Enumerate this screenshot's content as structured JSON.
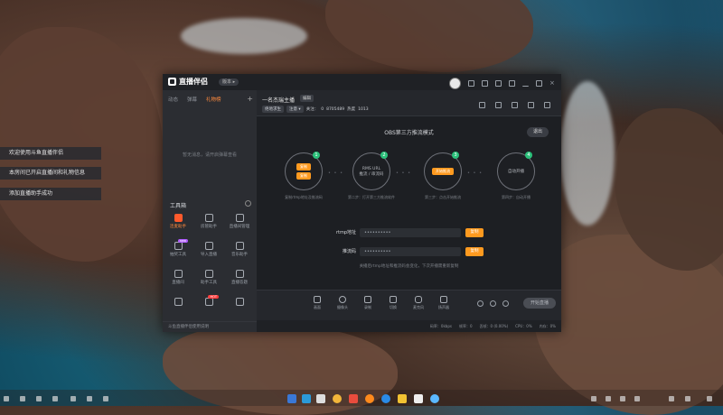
{
  "desktop": {
    "notifications": [
      "欢迎使用斗鱼直播伴侣",
      "本房间已开启直播间和礼物信息",
      "添加直播助手成功"
    ]
  },
  "window": {
    "app_name": "直播伴侣",
    "version_badge": "版本 ▸",
    "left": {
      "tabs": [
        "动态",
        "弹幕",
        "礼物榜"
      ],
      "plus": "+",
      "empty_text": "暂无消息，请开启弹幕查看",
      "tools_title": "工具箱",
      "tools": [
        {
          "label": "连麦助手",
          "tag": ""
        },
        {
          "label": "房管助手",
          "tag": ""
        },
        {
          "label": "直播间管理",
          "tag": ""
        },
        {
          "label": "抽奖工具",
          "tag": "new"
        },
        {
          "label": "导入直播",
          "tag": ""
        },
        {
          "label": "音乐助手",
          "tag": ""
        },
        {
          "label": "直播间",
          "tag": ""
        },
        {
          "label": "助手工具",
          "tag": ""
        },
        {
          "label": "直播答题",
          "tag": ""
        },
        {
          "label": "",
          "tag": ""
        },
        {
          "label": "",
          "tag": "HOT"
        },
        {
          "label": "",
          "tag": ""
        }
      ],
      "footer": "斗鱼直播伴侣使用说明"
    },
    "room": {
      "title": "一名杰瑞主播",
      "edit_label": "编辑",
      "category": "绝地求生",
      "level": "注意 ▾",
      "fans_label": "关注：",
      "fans_value": "0",
      "room_id": "8705489",
      "hot_label": "热度",
      "hot_value": "1013"
    },
    "obs": {
      "title": "OBS第三方推流模式",
      "exit_label": "退出",
      "steps": [
        {
          "num": "1",
          "pills": [
            "复制",
            "复制"
          ],
          "text": "",
          "caption": "复制rtmp地址及推流码"
        },
        {
          "num": "2",
          "pills": [],
          "text": "RMS URL\n推流 / 串流码",
          "caption": "第二步：打开第三方推流软件"
        },
        {
          "num": "3",
          "pills": [
            "开始推流"
          ],
          "text": "",
          "caption": "第三步：点击开始推流"
        },
        {
          "num": "4",
          "pills": [],
          "text": "自动开播",
          "caption": "第四步：自动开播"
        }
      ],
      "rtmp_label": "rtmp地址",
      "rtmp_value": "••••••••••",
      "key_label": "推流码",
      "key_value": "••••••••••",
      "copy_label": "复制",
      "hint": "关播后rtmp地址和推流码会变化，下次开播需重新复制"
    },
    "bottom_tools": [
      "画面",
      "摄像头",
      "录制",
      "切换",
      "麦克风",
      "扬声器"
    ],
    "start_label": "开始直播",
    "status": [
      "码率：0kbps",
      "帧率：0",
      "丢帧：0 (0.00%)",
      "CPU：0%",
      "内存：0%"
    ]
  }
}
